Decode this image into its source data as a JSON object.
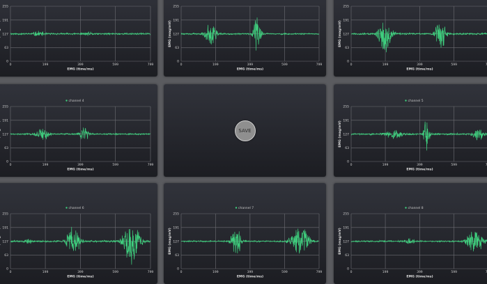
{
  "save_button": {
    "label": "SAVE"
  },
  "colors": {
    "signal": "#3fcf7e",
    "grid": "#6e6f75",
    "panel": "#26272d",
    "background": "#5a5b5f"
  },
  "chart_data": [
    {
      "type": "line",
      "title": "",
      "xlabel": "EMG (time/ms)",
      "ylabel": "EMG (mag/mV)",
      "x_ticks": [
        "0",
        "199",
        "399",
        "599",
        "799"
      ],
      "y_ticks": [
        "0",
        "63",
        "127",
        "191",
        "255"
      ],
      "xlim": [
        0,
        799
      ],
      "ylim": [
        0,
        255
      ],
      "baseline": 127,
      "bursts": [
        {
          "center": 160,
          "width": 60,
          "amp": 12
        },
        {
          "center": 440,
          "width": 50,
          "amp": 6
        }
      ],
      "noise": 5,
      "seed": 11
    },
    {
      "type": "line",
      "title": "",
      "xlabel": "EMG (time/ms)",
      "ylabel": "EMG (mag/mV)",
      "x_ticks": [
        "0",
        "199",
        "399",
        "599",
        "799"
      ],
      "y_ticks": [
        "0",
        "63",
        "127",
        "191",
        "255"
      ],
      "xlim": [
        0,
        799
      ],
      "ylim": [
        0,
        255
      ],
      "baseline": 127,
      "bursts": [
        {
          "center": 170,
          "width": 60,
          "amp": 70
        },
        {
          "center": 440,
          "width": 40,
          "amp": 95
        }
      ],
      "noise": 4,
      "seed": 22
    },
    {
      "type": "line",
      "title": "",
      "xlabel": "EMG (time/ms)",
      "ylabel": "EMG (mag/mV)",
      "x_ticks": [
        "0",
        "199",
        "399",
        "599",
        "799"
      ],
      "y_ticks": [
        "0",
        "63",
        "127",
        "191",
        "255"
      ],
      "xlim": [
        0,
        799
      ],
      "ylim": [
        0,
        255
      ],
      "baseline": 127,
      "bursts": [
        {
          "center": 200,
          "width": 70,
          "amp": 110
        },
        {
          "center": 520,
          "width": 55,
          "amp": 90
        }
      ],
      "noise": 5,
      "seed": 33
    },
    {
      "type": "line",
      "title": "channel 4",
      "xlabel": "EMG (time/ms)",
      "ylabel": "EMG (mag/mV)",
      "x_ticks": [
        "0",
        "199",
        "399",
        "599",
        "799"
      ],
      "y_ticks": [
        "0",
        "63",
        "127",
        "191",
        "255"
      ],
      "xlim": [
        0,
        799
      ],
      "ylim": [
        0,
        255
      ],
      "baseline": 127,
      "bursts": [
        {
          "center": 180,
          "width": 70,
          "amp": 35
        },
        {
          "center": 420,
          "width": 45,
          "amp": 45
        }
      ],
      "noise": 4,
      "seed": 44
    },
    {
      "type": "line",
      "title": "channel 5",
      "xlabel": "EMG (time/ms)",
      "ylabel": "EMG (mag/mV)",
      "x_ticks": [
        "0",
        "199",
        "399",
        "599",
        "799"
      ],
      "y_ticks": [
        "0",
        "63",
        "127",
        "191",
        "255"
      ],
      "xlim": [
        0,
        799
      ],
      "ylim": [
        0,
        255
      ],
      "baseline": 127,
      "bursts": [
        {
          "center": 250,
          "width": 80,
          "amp": 25
        },
        {
          "center": 440,
          "width": 30,
          "amp": 110
        },
        {
          "center": 740,
          "width": 60,
          "amp": 30
        }
      ],
      "noise": 5,
      "seed": 55
    },
    {
      "type": "line",
      "title": "channel 6",
      "xlabel": "EMG (time/ms)",
      "ylabel": "EMG (mag/mV)",
      "x_ticks": [
        "0",
        "199",
        "399",
        "599",
        "799"
      ],
      "y_ticks": [
        "0",
        "63",
        "127",
        "191",
        "255"
      ],
      "xlim": [
        0,
        799
      ],
      "ylim": [
        0,
        255
      ],
      "baseline": 127,
      "bursts": [
        {
          "center": 100,
          "width": 40,
          "amp": 12
        },
        {
          "center": 360,
          "width": 70,
          "amp": 90
        },
        {
          "center": 690,
          "width": 90,
          "amp": 120
        }
      ],
      "noise": 5,
      "seed": 66
    },
    {
      "type": "line",
      "title": "channel 7",
      "xlabel": "EMG (time/ms)",
      "ylabel": "EMG (mag/mV)",
      "x_ticks": [
        "0",
        "199",
        "399",
        "599",
        "799"
      ],
      "y_ticks": [
        "0",
        "63",
        "127",
        "191",
        "255"
      ],
      "xlim": [
        0,
        799
      ],
      "ylim": [
        0,
        255
      ],
      "baseline": 127,
      "bursts": [
        {
          "center": 320,
          "width": 55,
          "amp": 80
        },
        {
          "center": 690,
          "width": 90,
          "amp": 95
        }
      ],
      "noise": 4,
      "seed": 77
    },
    {
      "type": "line",
      "title": "channel 8",
      "xlabel": "EMG (time/ms)",
      "ylabel": "EMG (mag/mV)",
      "x_ticks": [
        "0",
        "199",
        "399",
        "599",
        "799"
      ],
      "y_ticks": [
        "0",
        "63",
        "127",
        "191",
        "255"
      ],
      "xlim": [
        0,
        799
      ],
      "ylim": [
        0,
        255
      ],
      "baseline": 127,
      "bursts": [
        {
          "center": 340,
          "width": 50,
          "amp": 12
        },
        {
          "center": 720,
          "width": 80,
          "amp": 80
        }
      ],
      "noise": 4,
      "seed": 88
    }
  ]
}
